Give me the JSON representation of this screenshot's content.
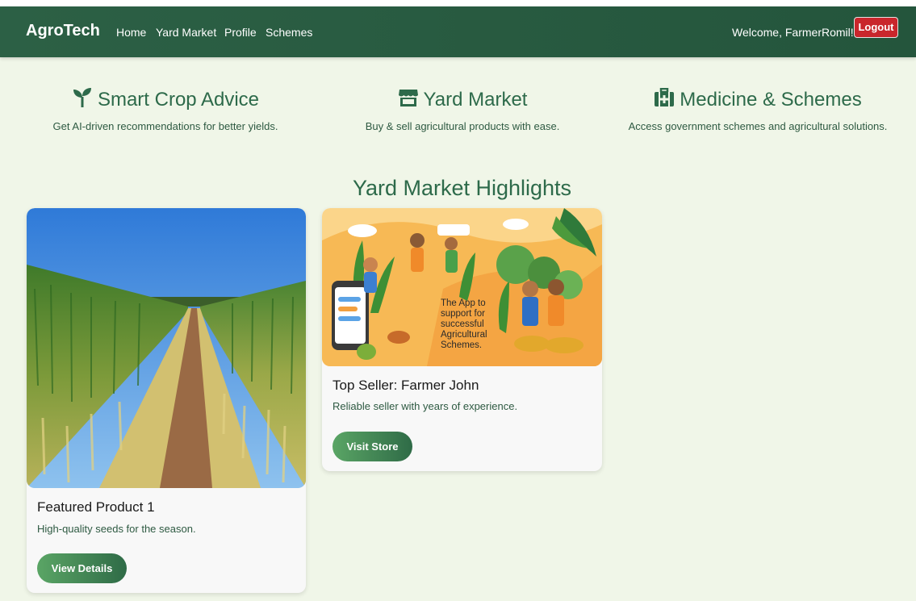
{
  "navbar": {
    "brand": "AgroTech",
    "links": [
      "Home",
      "Yard Market",
      "Profile",
      "Schemes"
    ],
    "welcome": "Welcome, FarmerRomil!",
    "logout_label": "Logout"
  },
  "features": [
    {
      "icon": "seedling-icon",
      "title": "Smart Crop Advice",
      "description": "Get AI-driven recommendations for better yields."
    },
    {
      "icon": "store-icon",
      "title": "Yard Market",
      "description": "Buy & sell agricultural products with ease."
    },
    {
      "icon": "medical-kit-icon",
      "title": "Medicine & Schemes",
      "description": "Access government schemes and agricultural solutions."
    }
  ],
  "highlights": {
    "title": "Yard Market Highlights",
    "cards": [
      {
        "image": "wheat-field-image",
        "title": "Featured Product 1",
        "description": "High-quality seeds for the season.",
        "button": "View Details"
      },
      {
        "image": "agri-app-illustration",
        "title": "Top Seller: Farmer John",
        "description": "Reliable seller with years of experience.",
        "button": "Visit Store",
        "image_text": "The App to support for successful Agricultural Schemes."
      }
    ]
  },
  "colors": {
    "navbar": "#24553c",
    "accent": "#2d6a4a",
    "logout": "#c9262c",
    "background": "#f0f6e8"
  }
}
